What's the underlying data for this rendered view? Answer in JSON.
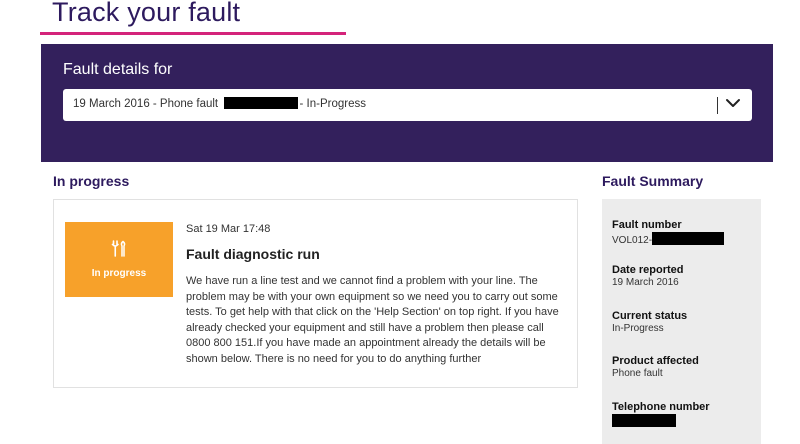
{
  "page": {
    "title": "Track your fault"
  },
  "fault_selector": {
    "heading": "Fault details for",
    "selected_prefix": "19 March 2016 - Phone fault",
    "selected_suffix": "- In-Progress"
  },
  "progress": {
    "heading": "In progress",
    "card": {
      "status_label": "In progress",
      "status_icon": "tools-icon",
      "date": "Sat 19 Mar 17:48",
      "title": "Fault diagnostic run",
      "body": "We have run a line test and we cannot find a problem with your line. The problem may be with your own equipment so we need you to carry out some tests. To get help with that click on the 'Help Section' on top right. If you have already checked your equipment and still have a problem then please call 0800 800 151.If you have made an appointment already the details will be shown below. There is no need for you to do anything further"
    }
  },
  "summary": {
    "heading": "Fault Summary",
    "fault_number_label": "Fault number",
    "fault_number_value": "VOL012-",
    "date_reported_label": "Date reported",
    "date_reported_value": "19 March 2016",
    "current_status_label": "Current status",
    "current_status_value": "In-Progress",
    "product_label": "Product affected",
    "product_value": "Phone fault",
    "telephone_label": "Telephone number"
  },
  "colors": {
    "brand_purple": "#33205c",
    "accent_pink": "#d4237a",
    "status_orange": "#f7a12a"
  }
}
